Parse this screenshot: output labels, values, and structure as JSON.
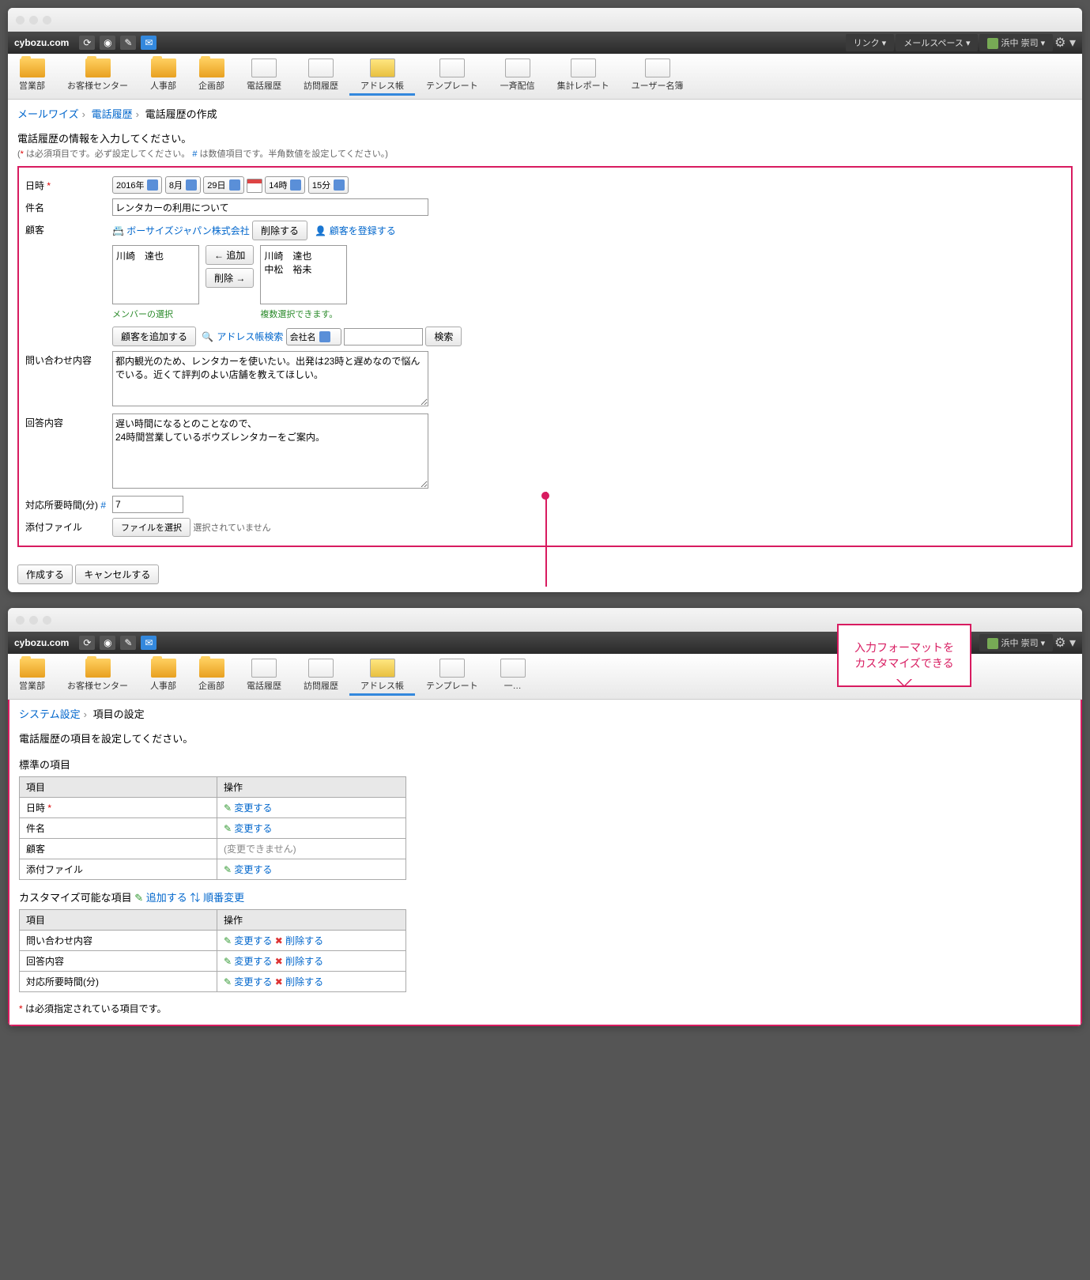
{
  "top": {
    "brand": "cybozu.com",
    "link": "リンク ▾",
    "mailspace": "メールスペース ▾",
    "user": "浜中 崇司 ▾"
  },
  "toolbar": [
    {
      "label": "営業部"
    },
    {
      "label": "お客様センター"
    },
    {
      "label": "人事部"
    },
    {
      "label": "企画部"
    },
    {
      "label": "電話履歴"
    },
    {
      "label": "訪問履歴"
    },
    {
      "label": "アドレス帳"
    },
    {
      "label": "テンプレート"
    },
    {
      "label": "一斉配信"
    },
    {
      "label": "集計レポート"
    },
    {
      "label": "ユーザー名簿"
    }
  ],
  "bc1": {
    "a": "メールワイズ",
    "b": "電話履歴",
    "c": "電話履歴の作成"
  },
  "instr1": "電話履歴の情報を入力してください。",
  "note1a": "(",
  "note1b": " は必須項目です。必ず設定してください。",
  "note1c": " は数値項目です。半角数値を設定してください。)",
  "labels": {
    "datetime": "日時",
    "subject": "件名",
    "customer": "顧客",
    "inquiry": "問い合わせ内容",
    "answer": "回答内容",
    "duration": "対応所要時間(分)",
    "attach": "添付ファイル"
  },
  "dt": {
    "year": "2016年",
    "month": "8月",
    "day": "29日",
    "hour": "14時",
    "min": "15分"
  },
  "subject": "レンタカーの利用について",
  "company": "ボーサイズジャパン株式会社",
  "btns": {
    "delete": "削除する",
    "regcust": "顧客を登録する",
    "add": "← 追加",
    "remove": "削除 →",
    "addcust": "顧客を追加する",
    "search": "検索",
    "choosefile": "ファイルを選択",
    "create": "作成する",
    "cancel": "キャンセルする"
  },
  "selmembers": [
    "川崎　達也"
  ],
  "allmembers": [
    "川崎　達也",
    "中松　裕未"
  ],
  "memnote1": "メンバーの選択",
  "memnote2": "複数選択できます。",
  "absearch": "アドレス帳検索",
  "abselect": "会社名",
  "inquiry": "都内観光のため、レンタカーを使いたい。出発は23時と遅めなので悩んでいる。近くて評判のよい店舗を教えてほしい。",
  "answer": "遅い時間になるとのことなので、\n24時間営業しているボウズレンタカーをご案内。",
  "duration": "7",
  "nofile": "選択されていません",
  "bc2": {
    "a": "システム設定",
    "b": "項目の設定"
  },
  "instr2": "電話履歴の項目を設定してください。",
  "std": {
    "title": "標準の項目",
    "col1": "項目",
    "col2": "操作",
    "rows": [
      {
        "name": "日時",
        "req": true,
        "op": "変更する"
      },
      {
        "name": "件名",
        "op": "変更する"
      },
      {
        "name": "顧客",
        "optext": "(変更できません)"
      },
      {
        "name": "添付ファイル",
        "op": "変更する"
      }
    ]
  },
  "cust": {
    "title": "カスタマイズ可能な項目",
    "add": "追加する",
    "reorder": "順番変更",
    "col1": "項目",
    "col2": "操作",
    "rows": [
      {
        "name": "問い合わせ内容",
        "op": "変更する",
        "del": "削除する"
      },
      {
        "name": "回答内容",
        "op": "変更する",
        "del": "削除する"
      },
      {
        "name": "対応所要時間(分)",
        "op": "変更する",
        "del": "削除する"
      }
    ]
  },
  "reqnote": " は必須指定されている項目です。",
  "callout": {
    "l1": "入力フォーマットを",
    "l2": "カスタマイズできる"
  }
}
